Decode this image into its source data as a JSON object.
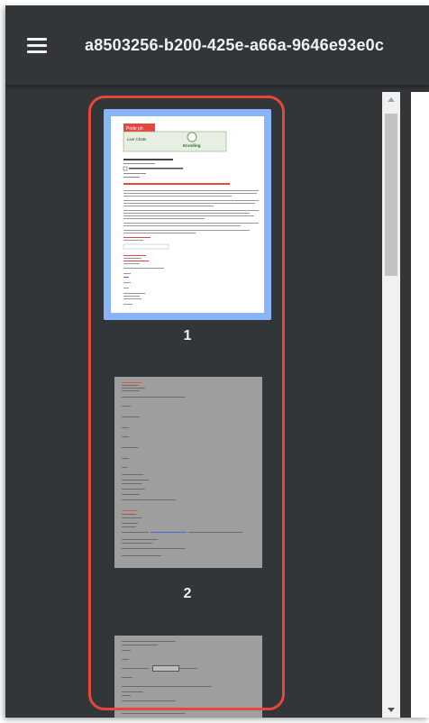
{
  "toolbar": {
    "title": "a8503256-b200-425e-a66a-9646e93e0c"
  },
  "icons": {
    "menu": "hamburger-menu-icon",
    "scroll_up": "arrow-up-icon",
    "scroll_down": "arrow-down-icon"
  },
  "thumbnails": [
    {
      "page_number": "1",
      "selected": true
    },
    {
      "page_number": "2",
      "selected": false
    },
    {
      "page_number": "",
      "selected": false
    }
  ],
  "page1_preview": {
    "badge": "Pride ph",
    "header_text": "Live Chats",
    "logo_text": "Enrolling"
  },
  "colors": {
    "toolbar_bg": "#323639",
    "selection_border": "#8ab4f8",
    "annotation_highlight": "#e8453c",
    "page_text": "#f1f1f1"
  }
}
